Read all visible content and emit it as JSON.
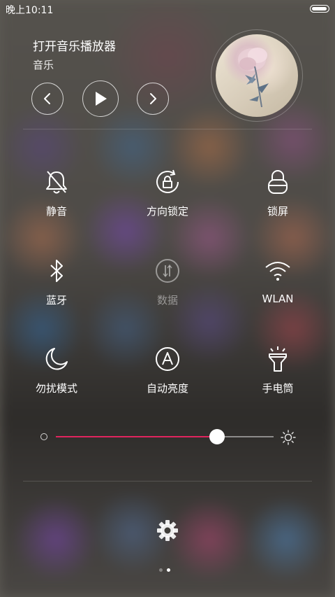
{
  "status_bar": {
    "time": "晚上10:11",
    "battery_level": 1.0
  },
  "music": {
    "title": "打开音乐播放器",
    "subtitle": "音乐",
    "prev_icon": "chevron-left-icon",
    "play_icon": "play-icon",
    "next_icon": "chevron-right-icon"
  },
  "toggles": [
    {
      "label": "静音",
      "icon": "bell-off-icon",
      "active": true
    },
    {
      "label": "方向锁定",
      "icon": "rotation-lock-icon",
      "active": true
    },
    {
      "label": "锁屏",
      "icon": "lock-icon",
      "active": true
    },
    {
      "label": "蓝牙",
      "icon": "bluetooth-icon",
      "active": true
    },
    {
      "label": "数据",
      "icon": "mobile-data-icon",
      "active": false
    },
    {
      "label": "WLAN",
      "icon": "wifi-icon",
      "active": true
    },
    {
      "label": "勿扰模式",
      "icon": "moon-icon",
      "active": true
    },
    {
      "label": "自动亮度",
      "icon": "auto-brightness-icon",
      "active": true
    },
    {
      "label": "手电筒",
      "icon": "flashlight-icon",
      "active": true
    }
  ],
  "brightness": {
    "level": 0.74,
    "accent_color": "#e0245e"
  },
  "pager": {
    "pages": 2,
    "current": 2
  }
}
